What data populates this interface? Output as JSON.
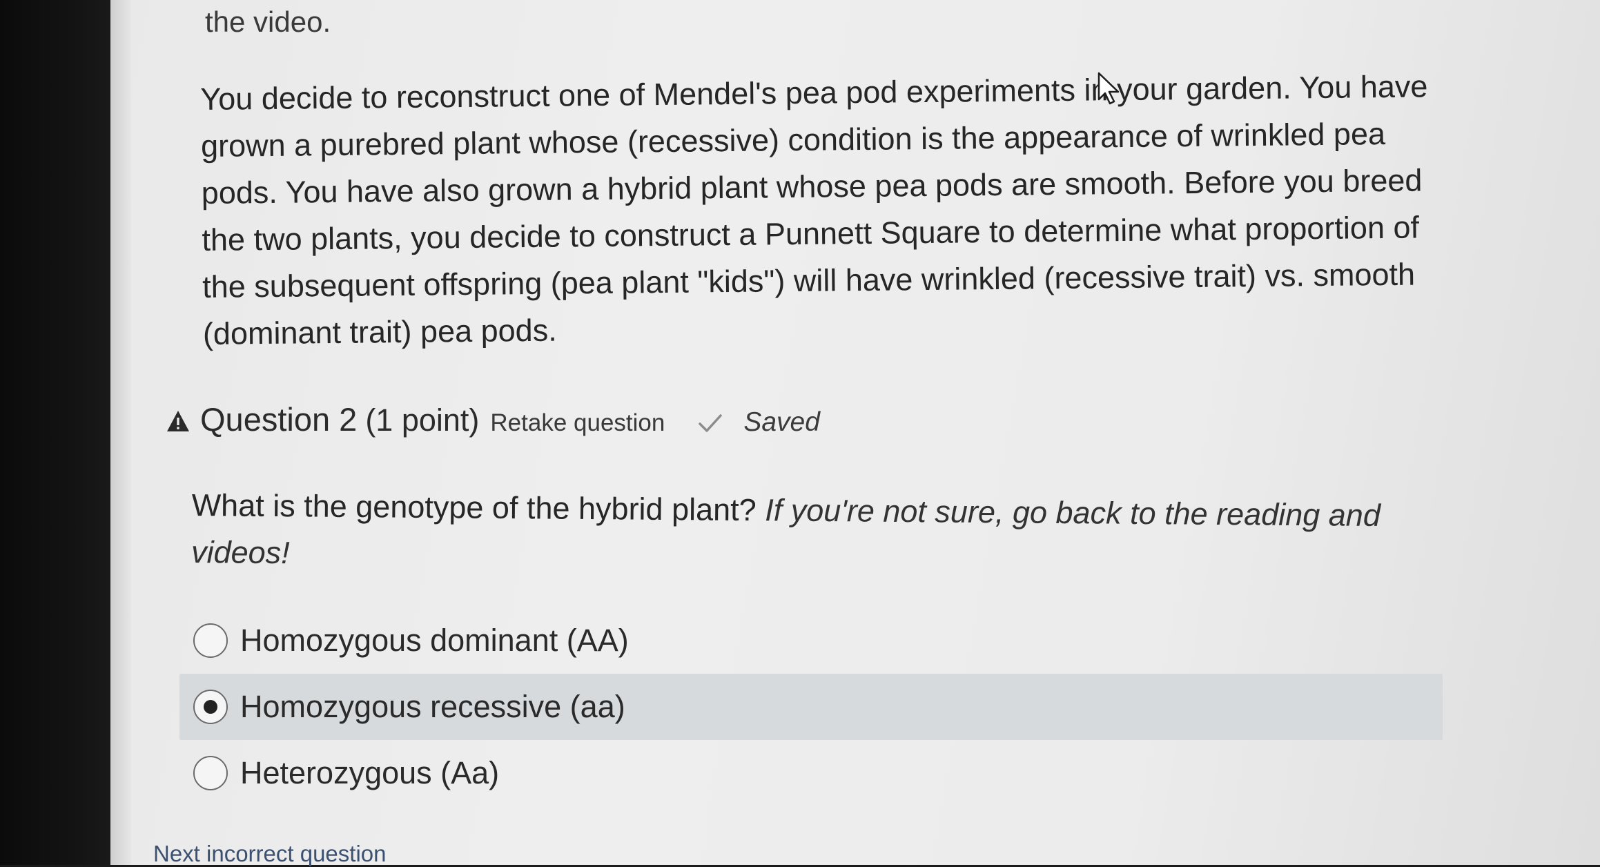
{
  "page": {
    "prev_text": "the video.",
    "passage": "You decide to reconstruct one of Mendel's pea pod experiments in your garden. You have grown a purebred plant whose (recessive) condition is the appearance of wrinkled pea pods. You have also grown a hybrid plant whose pea pods are smooth. Before you breed the two plants, you decide to construct a Punnett Square to determine what proportion of the subsequent offspring (pea plant \"kids\") will have wrinkled (recessive trait) vs. smooth (dominant trait) pea pods."
  },
  "question": {
    "title": "Question 2",
    "points": "(1 point)",
    "retake_label": "Retake question",
    "saved_label": "Saved",
    "text": "What is the genotype of the hybrid plant?",
    "hint": "If you're not sure, go back to the reading and videos!",
    "options": [
      {
        "label": "Homozygous dominant (AA)",
        "selected": false
      },
      {
        "label": "Homozygous recessive (aa)",
        "selected": true
      },
      {
        "label": "Heterozygous (Aa)",
        "selected": false
      }
    ]
  },
  "footer": {
    "next_label": "Next incorrect question"
  },
  "icons": {
    "warning": "warning-triangle-icon",
    "saved": "checkmark-icon",
    "cursor": "mouse-pointer-icon"
  },
  "colors": {
    "selected_bg": "#d7dadd",
    "link": "#3c5170"
  }
}
